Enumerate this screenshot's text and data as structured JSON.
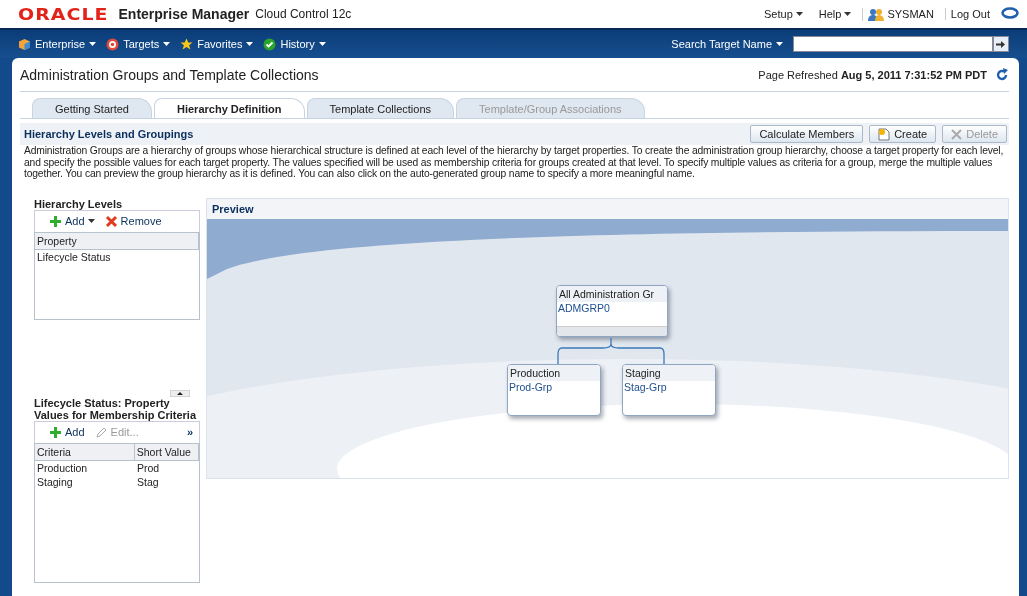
{
  "brand": {
    "logo": "ORACLE",
    "product": "Enterprise Manager",
    "edition": "Cloud Control 12c"
  },
  "header_links": [
    {
      "label": "Setup",
      "kind": "menu"
    },
    {
      "label": "Help",
      "kind": "menu"
    },
    {
      "label": "SYSMAN",
      "kind": "user"
    },
    {
      "label": "Log Out",
      "kind": "link"
    }
  ],
  "nav_menus": [
    {
      "label": "Enterprise",
      "kind": "cube"
    },
    {
      "label": "Targets",
      "kind": "target"
    },
    {
      "label": "Favorites",
      "kind": "star"
    },
    {
      "label": "History",
      "kind": "check"
    }
  ],
  "search": {
    "label": "Search Target Name"
  },
  "page": {
    "title": "Administration Groups and Template Collections",
    "refreshed_label": "Page Refreshed",
    "refreshed_time": "Aug 5, 2011 7:31:52 PM PDT"
  },
  "tabs": [
    {
      "label": "Getting Started",
      "selected": false,
      "disabled": false
    },
    {
      "label": "Hierarchy Definition",
      "selected": true,
      "disabled": false
    },
    {
      "label": "Template Collections",
      "selected": false,
      "disabled": false
    },
    {
      "label": "Template/Group Associations",
      "selected": false,
      "disabled": true
    }
  ],
  "section": {
    "title": "Hierarchy Levels and Groupings",
    "description": "Administration Groups are a hierarchy of groups whose hierarchical structure is defined at each level of the hierarchy by target properties. To create the administration group hierarchy, choose a target property for each level, and specify the possible values for each target property. The values specified will be used as membership criteria for groups created at that level. To specify multiple values as criteria for a group, merge the multiple values together. You can preview the group hierarchy as it is defined. You can also click on the auto-generated group name to specify a more meaningful name.",
    "buttons": [
      {
        "label": "Calculate Members",
        "kind": "plain",
        "disabled": false
      },
      {
        "label": "Create",
        "kind": "create",
        "disabled": false
      },
      {
        "label": "Delete",
        "kind": "delete",
        "disabled": true
      }
    ]
  },
  "hierarchy_levels": {
    "title": "Hierarchy Levels",
    "toolbar": [
      {
        "label": "Add",
        "kind": "add",
        "disabled": false
      },
      {
        "label": "Remove",
        "kind": "remove",
        "disabled": false
      }
    ],
    "columns": [
      "Property"
    ],
    "rows": [
      [
        "Lifecycle Status"
      ]
    ]
  },
  "criteria": {
    "title": "Lifecycle Status: Property Values for Membership Criteria",
    "toolbar": [
      {
        "label": "Add",
        "kind": "add",
        "disabled": false
      },
      {
        "label": "Edit...",
        "kind": "edit",
        "disabled": true
      }
    ],
    "more": "»",
    "columns": [
      "Criteria",
      "Short Value"
    ],
    "rows": [
      [
        "Production",
        "Prod"
      ],
      [
        "Staging",
        "Stag"
      ]
    ]
  },
  "preview": {
    "title": "Preview",
    "tree": {
      "name": "All Administration Gr",
      "group": "ADMGRP0",
      "children": [
        {
          "name": "Production",
          "group": "Prod-Grp"
        },
        {
          "name": "Staging",
          "group": "Stag-Grp"
        }
      ]
    }
  }
}
